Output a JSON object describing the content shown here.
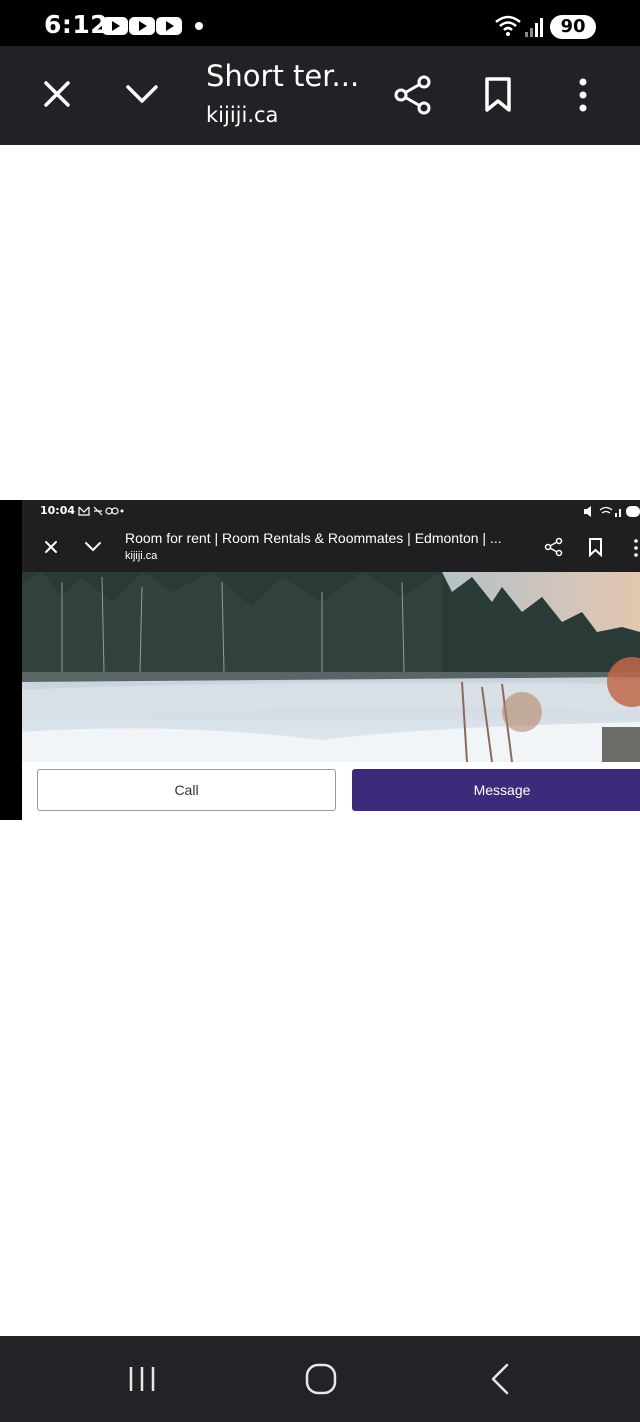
{
  "status_bar": {
    "time": "6:12",
    "battery": "90"
  },
  "toolbar": {
    "title": "Short ter...",
    "domain": "kijiji.ca"
  },
  "inner_screenshot": {
    "status_time": "10:04",
    "title": "Room for rent | Room Rentals & Roommates | Edmonton | ...",
    "domain": "kijiji.ca",
    "call_label": "Call",
    "message_label": "Message"
  },
  "colors": {
    "toolbar_bg": "#212225",
    "message_button": "#3b2b7a"
  },
  "icons": [
    "close-icon",
    "chevron-down-icon",
    "share-icon",
    "bookmark-icon",
    "more-vert-icon",
    "recent-apps-icon",
    "home-icon",
    "back-icon"
  ]
}
